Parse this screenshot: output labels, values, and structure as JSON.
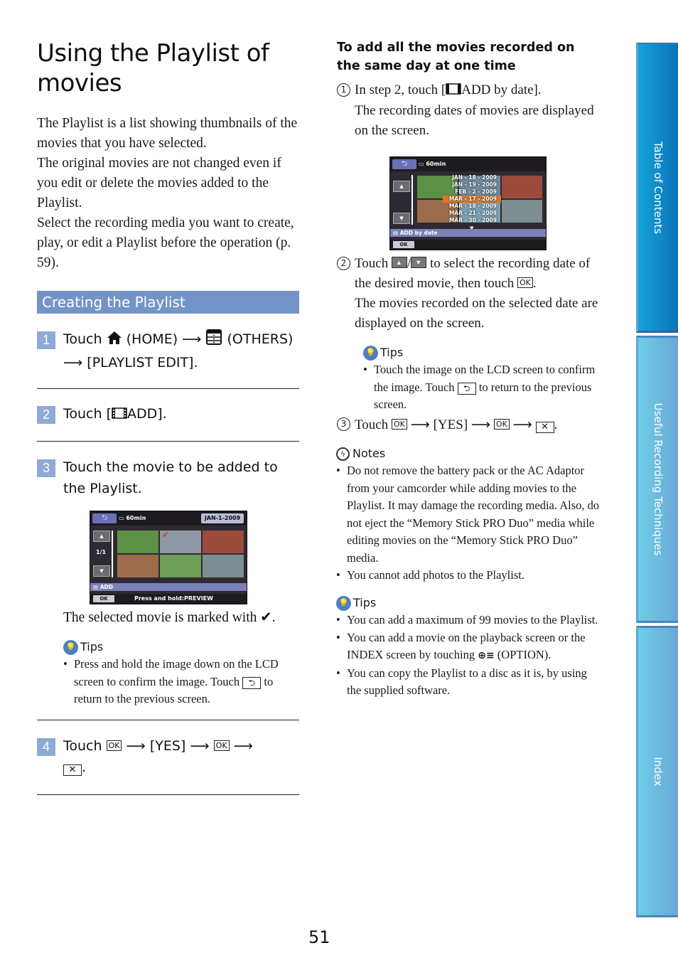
{
  "page": {
    "title": "Using the Playlist of movies",
    "intro": [
      "The Playlist is a list showing thumbnails of the movies that you have selected.",
      "The original movies are not changed even if you edit or delete the movies added to the Playlist.",
      "Select the recording media you want to create, play, or edit a Playlist before the operation (p. 59)."
    ],
    "page_number": "51"
  },
  "section": {
    "title": "Creating the Playlist",
    "steps": [
      {
        "num": "1",
        "touch": "Touch",
        "home": "(HOME)",
        "others": "(OTHERS)",
        "menu": "[PLAYLIST EDIT]."
      },
      {
        "num": "2",
        "touch": "Touch [",
        "add": "ADD]."
      },
      {
        "num": "3",
        "text": "Touch the movie to be added to the Playlist.",
        "note": "The selected movie is marked with",
        "check": "✔."
      },
      {
        "num": "4",
        "touch": "Touch",
        "ok": "OK",
        "yes": "[YES]",
        "period": "."
      }
    ],
    "tips": {
      "label": "Tips",
      "items": [
        {
          "before": "Press and hold the image down on the LCD screen to confirm the image. Touch",
          "after": "to return to the previous screen."
        }
      ]
    }
  },
  "lcd_add": {
    "battery": "60min",
    "date": "JAN-1-2009",
    "page": "1/1",
    "strip": "ADD",
    "ok": "OK",
    "hint": "Press and hold:PREVIEW",
    "thumbnails": [
      {
        "subject": "dalmatian dog on grass",
        "checked": false,
        "color": "#5d8f45"
      },
      {
        "subject": "dogs on beach",
        "checked": true,
        "color": "#8e98a4"
      },
      {
        "subject": "red flowers garden",
        "checked": true,
        "color": "#9b4a3c"
      },
      {
        "subject": "runners race",
        "checked": false,
        "color": "#9c6d4c"
      },
      {
        "subject": "golf course flag",
        "checked": false,
        "color": "#6f9f56"
      },
      {
        "subject": "child on swing",
        "checked": false,
        "color": "#7c8e92"
      }
    ]
  },
  "right": {
    "subheading": "To add all the movies recorded on the same day at one time",
    "step1": {
      "num": "1",
      "before": "In step 2, touch [",
      "after": "ADD by date].",
      "desc": "The recording dates of movies are displayed on the screen."
    },
    "step2": {
      "num": "2",
      "touch": "Touch",
      "mid": "to select the recording date of the desired movie, then touch",
      "ok": "OK",
      "end": ".",
      "desc": "The movies recorded on the selected date are displayed on the screen."
    },
    "tips1": {
      "label": "Tips",
      "before": "Touch the image on the LCD screen to confirm the image. Touch",
      "after": "to return to the previous screen."
    },
    "step3": {
      "num": "3",
      "touch": "Touch",
      "ok": "OK",
      "yes": "[YES]",
      "period": "."
    },
    "notes": {
      "label": "Notes",
      "items": [
        "Do not remove the battery pack or the AC Adaptor from your camcorder while adding movies to the Playlist. It may damage the recording media. Also, do not eject the “Memory Stick PRO Duo” media while editing movies on the “Memory Stick PRO Duo” media.",
        "You cannot add photos to the Playlist."
      ]
    },
    "tips2": {
      "label": "Tips",
      "items": [
        {
          "text": "You can add a maximum of 99 movies to the Playlist."
        },
        {
          "before": "You can add a movie on the playback screen or the INDEX screen by touching",
          "after": "(OPTION)."
        },
        {
          "text": "You can copy the Playlist to a disc as it is, by using the supplied software."
        }
      ]
    }
  },
  "lcd_date": {
    "battery": "60min",
    "strip": "ADD by date",
    "ok": "OK",
    "dates": [
      "JAN - 18 - 2009",
      "JAN - 19 - 2009",
      "FEB -  2 - 2009",
      "MAR - 17 - 2009",
      "MAR - 18 - 2009",
      "MAR - 21 - 2009",
      "MAR - 30 - 2009"
    ],
    "selected_index": 3
  },
  "sidetabs": [
    {
      "label": "Table of Contents"
    },
    {
      "label": "Useful Recording Techniques"
    },
    {
      "label": "Index"
    }
  ]
}
